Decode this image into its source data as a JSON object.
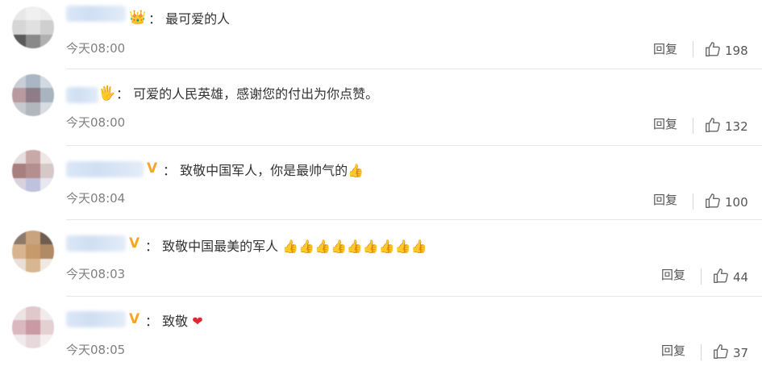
{
  "comments": [
    {
      "text": "最可爱的人",
      "badge": "👑",
      "time": "今天08:00",
      "reply_label": "回复",
      "likes": "198",
      "avatar_colors": [
        "#e8e8e8",
        "#f0f0f0",
        "#ececec",
        "#d6d6d6",
        "#e0e0e0",
        "#cfcfcf",
        "#5a5a5a",
        "#8a8a8a",
        "#b0b0b0"
      ]
    },
    {
      "text": "可爱的人民英雄，感谢您的付出为你点赞。",
      "badge": "🖐",
      "time": "今天08:00",
      "reply_label": "回复",
      "likes": "132",
      "avatar_colors": [
        "#c9ced6",
        "#aab6c4",
        "#d3d9e0",
        "#b89aa0",
        "#8e7c86",
        "#a8b4c0",
        "#c6c9cf",
        "#b2b7bd",
        "#d8dbe0"
      ]
    },
    {
      "text": "致敬中国军人，你是最帅气的",
      "emoji": "👍",
      "badge": "V",
      "time": "今天08:04",
      "reply_label": "回复",
      "likes": "100",
      "avatar_colors": [
        "#e6dede",
        "#c9a9a8",
        "#efe6e6",
        "#a77f7e",
        "#b58f8e",
        "#d7c8c8",
        "#d9d2de",
        "#bfc2dc",
        "#e8e6ef"
      ]
    },
    {
      "text": "致敬中国最美的军人",
      "emoji": "👍👍👍👍👍👍👍👍👍",
      "badge": "V",
      "time": "今天08:03",
      "reply_label": "回复",
      "likes": "44",
      "avatar_colors": [
        "#8c7a6a",
        "#c8a37e",
        "#6f5d4e",
        "#d8b58f",
        "#c79a6a",
        "#b18a66",
        "#e8dfd8",
        "#d9b692",
        "#efe9e3"
      ]
    },
    {
      "text": "致敬",
      "emoji": "❤",
      "badge": "V",
      "time": "今天08:05",
      "reply_label": "回复",
      "likes": "37",
      "avatar_colors": [
        "#ece3e5",
        "#e0c8cc",
        "#f2eaec",
        "#d9b9bf",
        "#c99aa3",
        "#e4cfd3",
        "#f1e9eb",
        "#e7d8db",
        "#f5eff0"
      ]
    }
  ],
  "colors": {
    "badge_v": "#f5a623",
    "heart": "#e0282e",
    "time_text": "#808080",
    "divider": "#e6e6e6"
  },
  "icons": {
    "like": "thumbs-up-outline-icon"
  }
}
